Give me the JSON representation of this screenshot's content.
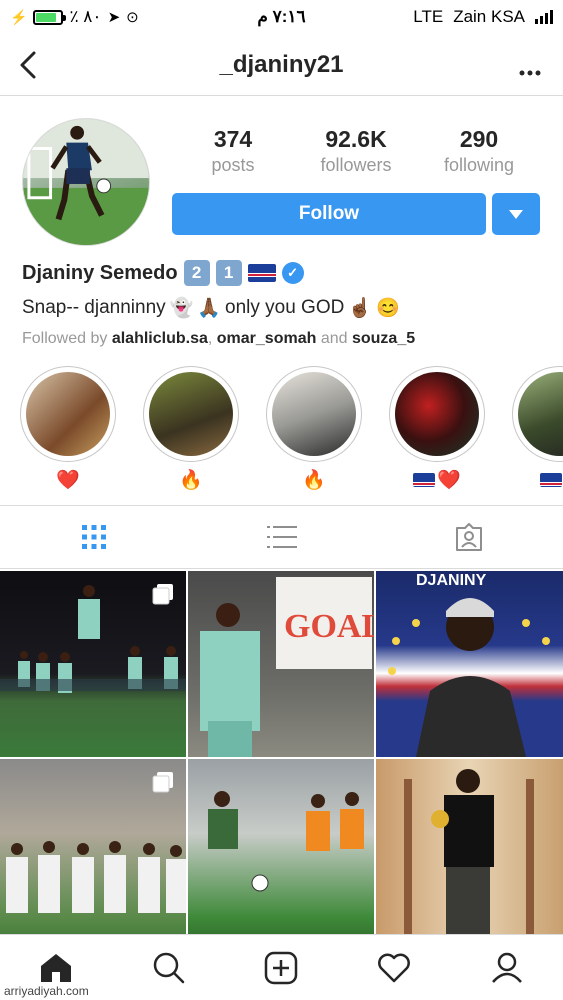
{
  "status_bar": {
    "battery_percent_text": "٪ ٨٠",
    "time": "٧:١٦ م",
    "network": "LTE",
    "carrier": "Zain KSA",
    "battery_level": 0.8
  },
  "nav": {
    "title": "_djaniny21",
    "back_icon": "chevron-left-icon",
    "more_icon": "ellipsis-icon"
  },
  "stats": {
    "posts_value": "374",
    "posts_label": "posts",
    "followers_value": "92.6K",
    "followers_label": "followers",
    "following_value": "290",
    "following_label": "following"
  },
  "follow_button": {
    "label": "Follow",
    "dropdown_icon": "caret-down-icon"
  },
  "profile": {
    "name": "Djaniny Semedo",
    "badges": [
      "2",
      "1"
    ],
    "bio_prefix": "Snap-- djanninny",
    "bio_mid": "only you GOD",
    "followed_by_prefix": "Followed by",
    "followed_by_users": [
      "alahliclub.sa",
      "omar_somah",
      "souza_5"
    ],
    "followed_by_and": "and"
  },
  "highlights": [
    {
      "label_emoji": "❤️"
    },
    {
      "label_emoji": "🔥"
    },
    {
      "label_emoji": "🔥"
    },
    {
      "label_emoji": "❤️"
    },
    {
      "label_emoji": "❤"
    }
  ],
  "tabs": [
    "grid-icon",
    "list-icon",
    "tagged-icon"
  ],
  "bottom_nav": [
    "home-icon",
    "search-icon",
    "add-post-icon",
    "activity-heart-icon",
    "profile-icon"
  ],
  "watermark": "arriyadiyah.com",
  "colors": {
    "accent": "#3897f0",
    "text": "#262626",
    "muted": "#999999",
    "border": "#dbdbdb"
  }
}
